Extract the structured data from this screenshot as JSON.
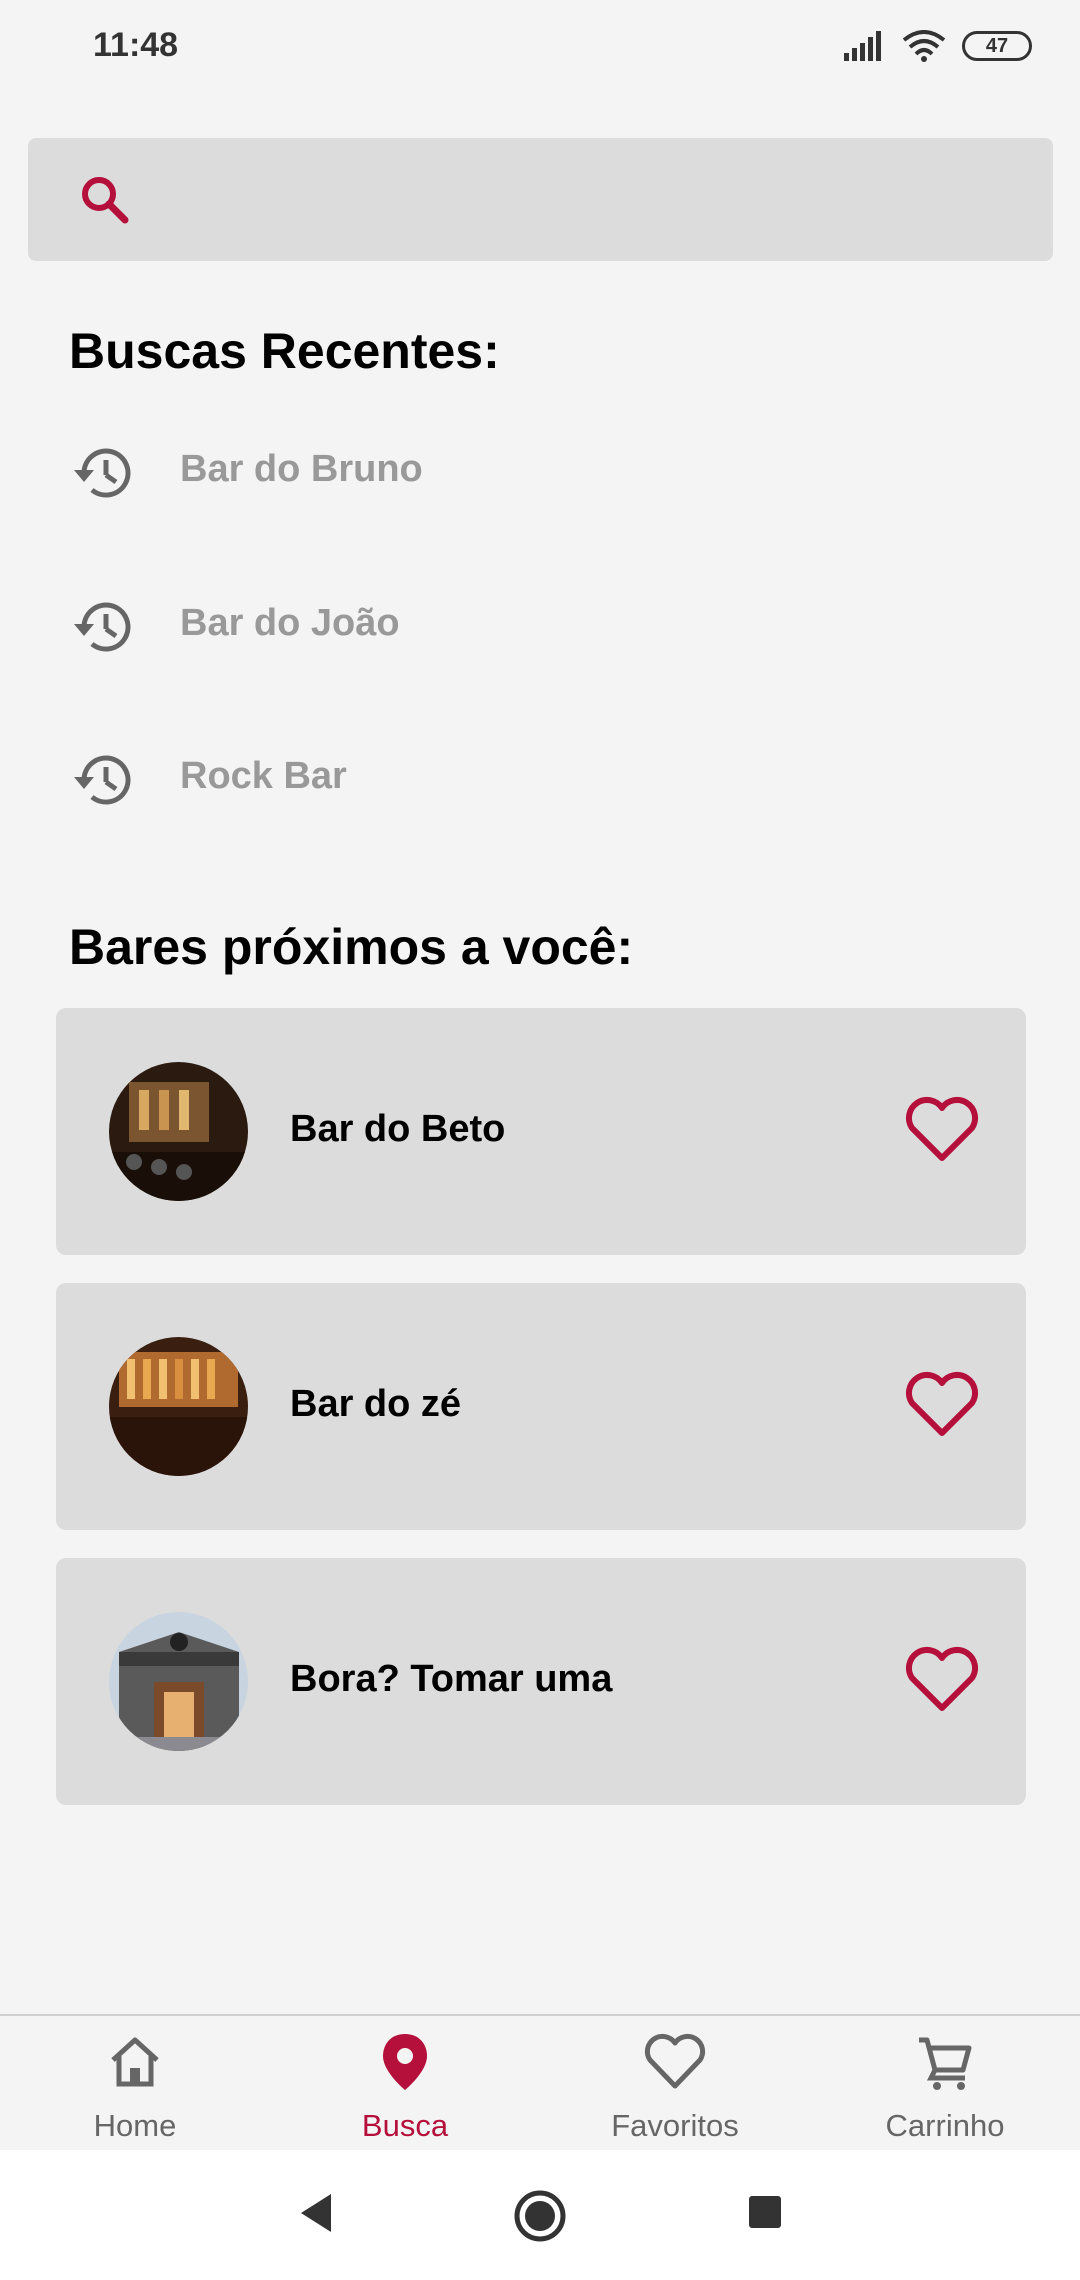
{
  "status_bar": {
    "time": "11:48",
    "battery": "47"
  },
  "search": {
    "placeholder": ""
  },
  "recent": {
    "title": "Buscas Recentes:",
    "items": [
      {
        "label": "Bar do Bruno"
      },
      {
        "label": "Bar do João"
      },
      {
        "label": "Rock Bar"
      }
    ]
  },
  "nearby": {
    "title": "Bares próximos a você:",
    "bars": [
      {
        "name": "Bar do Beto",
        "favorite_icon": "heart-outline-icon"
      },
      {
        "name": "Bar do zé",
        "favorite_icon": "heart-outline-icon"
      },
      {
        "name": "Bora? Tomar uma",
        "favorite_icon": "heart-outline-icon"
      }
    ]
  },
  "bottom_nav": {
    "items": [
      {
        "label": "Home",
        "icon": "home-icon",
        "active": false
      },
      {
        "label": "Busca",
        "icon": "map-pin-icon",
        "active": true
      },
      {
        "label": "Favoritos",
        "icon": "heart-icon",
        "active": false
      },
      {
        "label": "Carrinho",
        "icon": "cart-icon",
        "active": false
      }
    ]
  },
  "colors": {
    "accent": "#b5103b",
    "card": "#dcdcdc",
    "background": "#f4f4f4",
    "muted_text": "#999999"
  }
}
